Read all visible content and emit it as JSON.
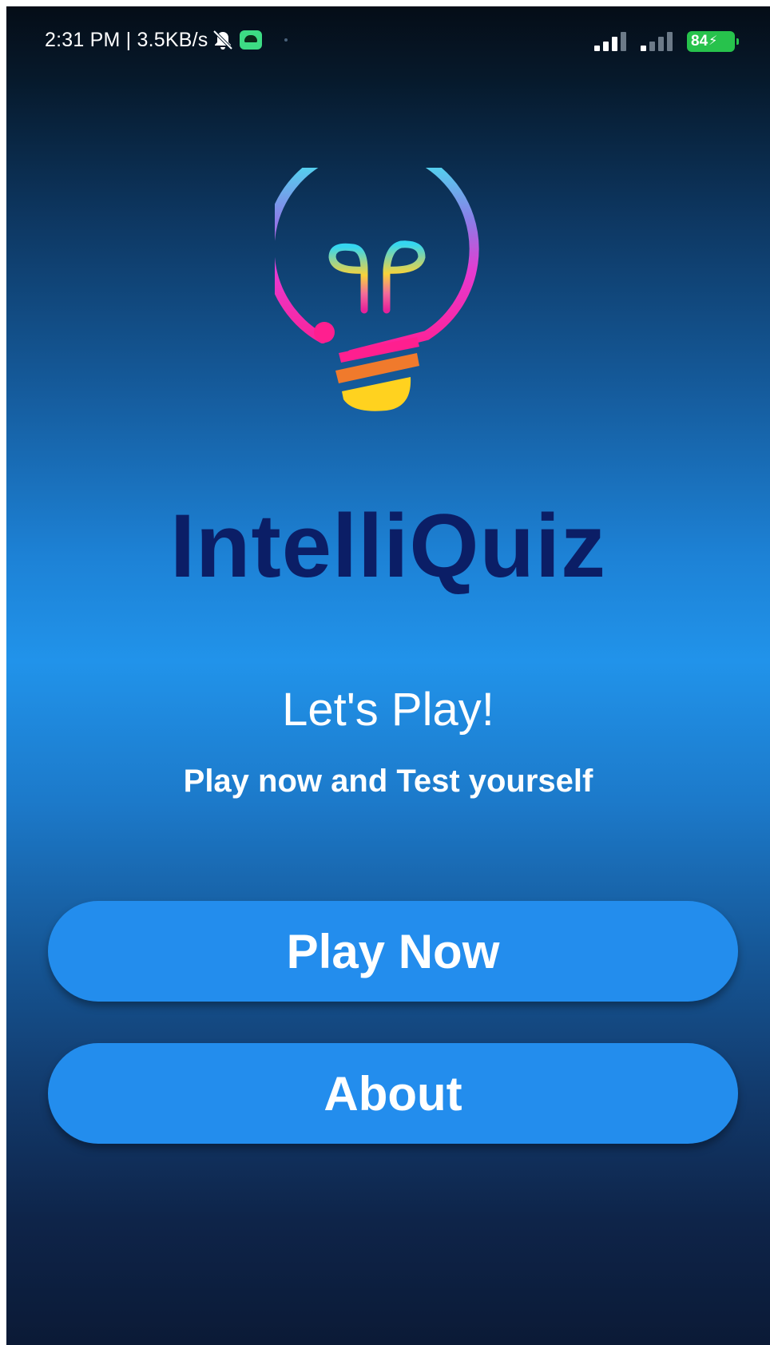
{
  "status_bar": {
    "time_and_speed": "2:31 PM | 3.5KB/s",
    "battery": "84",
    "icons": [
      "notifications-muted-icon",
      "android-app-icon",
      "signal-icon",
      "signal-icon",
      "battery-charging-icon"
    ]
  },
  "app": {
    "logo": "lightbulb-logo-icon",
    "title": "IntelliQuiz",
    "headline": "Let's Play!",
    "subline": "Play now and Test yourself"
  },
  "buttons": {
    "play": "Play Now",
    "about": "About"
  },
  "colors": {
    "title": "#0b1e66",
    "button": "#238ded",
    "battery": "#27c24c"
  }
}
